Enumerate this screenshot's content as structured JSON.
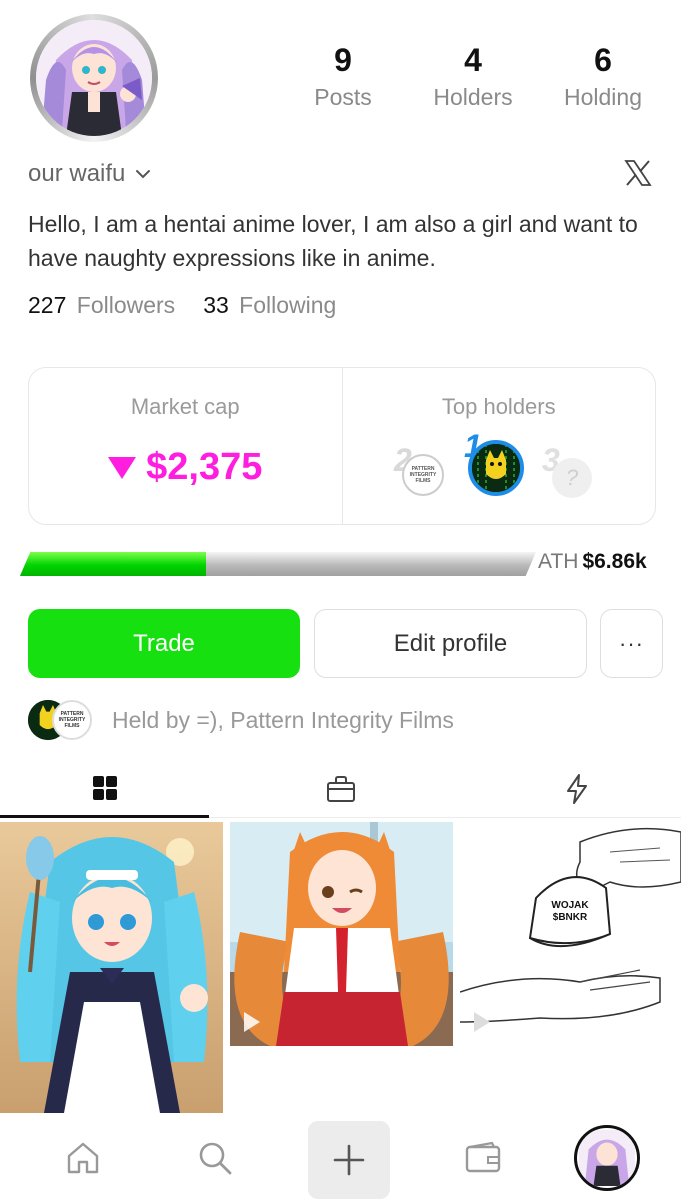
{
  "profile": {
    "username": "our waifu",
    "bio": "Hello, I am a hentai anime lover, I am also a girl and want to have naughty expressions like in anime.",
    "stats": [
      {
        "value": "9",
        "label": "Posts"
      },
      {
        "value": "4",
        "label": "Holders"
      },
      {
        "value": "6",
        "label": "Holding"
      }
    ],
    "followers_count": "227",
    "followers_label": "Followers",
    "following_count": "33",
    "following_label": "Following",
    "social_icon": "x-logo-icon"
  },
  "market": {
    "market_cap_label": "Market cap",
    "market_cap_value": "$2,375",
    "trend": "down",
    "trend_color": "#ff1ee0",
    "top_holders_label": "Top holders",
    "top_holders": [
      {
        "rank": "1",
        "avatar_text": ""
      },
      {
        "rank": "2",
        "avatar_text": "PATTERN INTEGRITY FILMS"
      },
      {
        "rank": "3",
        "avatar_text": "?"
      }
    ],
    "progress_fraction": 0.36,
    "ath_label": "ATH",
    "ath_value": "$6.86k"
  },
  "actions": {
    "trade_label": "Trade",
    "edit_label": "Edit profile",
    "more_label": "···",
    "trade_color": "#16e00f"
  },
  "held_by": {
    "text": "Held by =), Pattern Integrity Films",
    "avatar_text": "PATTERN INTEGRITY FILMS"
  },
  "tabs": [
    {
      "icon": "grid-icon",
      "active": true
    },
    {
      "icon": "shopping-bag-icon",
      "active": false
    },
    {
      "icon": "lightning-icon",
      "active": false
    }
  ],
  "posts": [
    {
      "description_icon": "anime-maid-image",
      "video": false
    },
    {
      "description_icon": "anime-fox-girl-image",
      "video": true
    },
    {
      "description_icon": "hand-cap-sketch-image",
      "video": true,
      "cap_text_line1": "WOJAK",
      "cap_text_line2": "$BNKR"
    }
  ],
  "bottom_nav": [
    "home-icon",
    "search-icon",
    "plus-icon",
    "wallet-icon",
    "profile-avatar"
  ]
}
